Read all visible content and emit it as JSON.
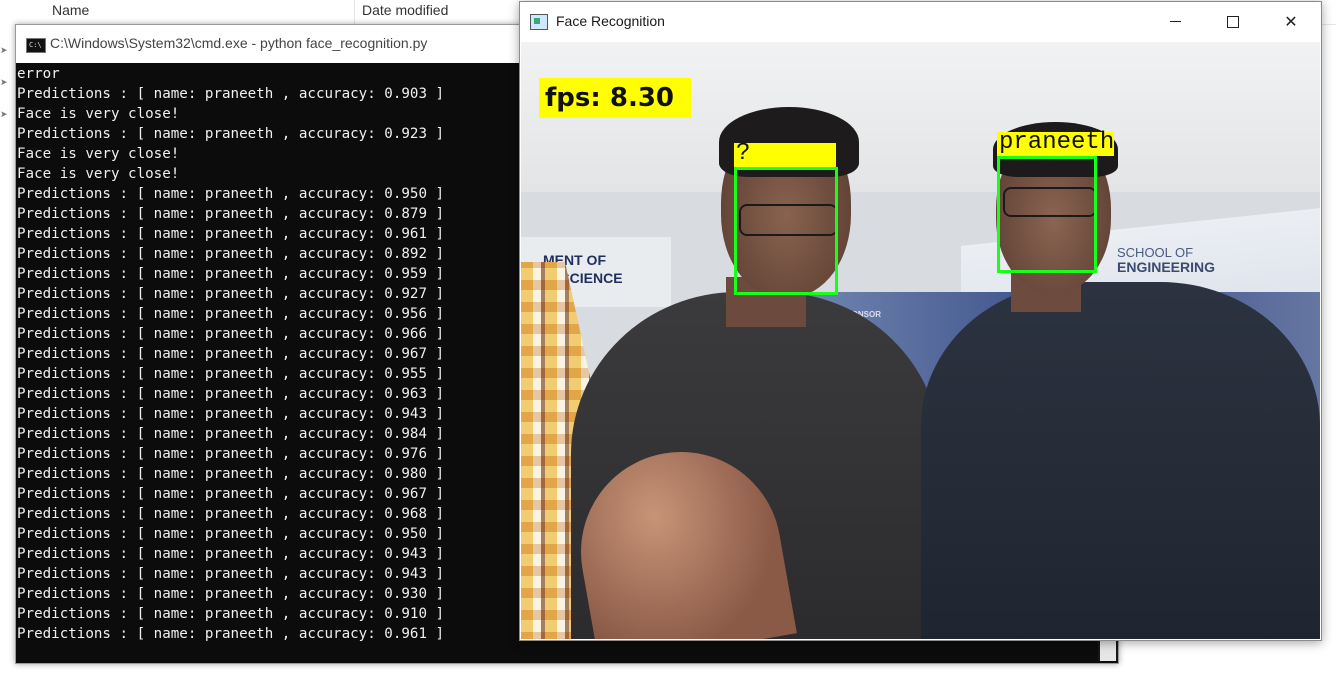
{
  "explorer": {
    "columns": [
      "Name",
      "Date modified"
    ]
  },
  "cmd": {
    "title": "C:\\Windows\\System32\\cmd.exe - python  face_recognition.py",
    "icon": "cmd-icon",
    "lines": [
      "error",
      "Predictions : [ name: praneeth , accuracy: 0.903 ]",
      "Face is very close!",
      "Predictions : [ name: praneeth , accuracy: 0.923 ]",
      "Face is very close!",
      "Face is very close!",
      "Predictions : [ name: praneeth , accuracy: 0.950 ]",
      "Predictions : [ name: praneeth , accuracy: 0.879 ]",
      "Predictions : [ name: praneeth , accuracy: 0.961 ]",
      "Predictions : [ name: praneeth , accuracy: 0.892 ]",
      "Predictions : [ name: praneeth , accuracy: 0.959 ]",
      "Predictions : [ name: praneeth , accuracy: 0.927 ]",
      "Predictions : [ name: praneeth , accuracy: 0.956 ]",
      "Predictions : [ name: praneeth , accuracy: 0.966 ]",
      "Predictions : [ name: praneeth , accuracy: 0.967 ]",
      "Predictions : [ name: praneeth , accuracy: 0.955 ]",
      "Predictions : [ name: praneeth , accuracy: 0.963 ]",
      "Predictions : [ name: praneeth , accuracy: 0.943 ]",
      "Predictions : [ name: praneeth , accuracy: 0.984 ]",
      "Predictions : [ name: praneeth , accuracy: 0.976 ]",
      "Predictions : [ name: praneeth , accuracy: 0.980 ]",
      "Predictions : [ name: praneeth , accuracy: 0.967 ]",
      "Predictions : [ name: praneeth , accuracy: 0.968 ]",
      "Predictions : [ name: praneeth , accuracy: 0.950 ]",
      "Predictions : [ name: praneeth , accuracy: 0.943 ]",
      "Predictions : [ name: praneeth , accuracy: 0.943 ]",
      "Predictions : [ name: praneeth , accuracy: 0.930 ]",
      "Predictions : [ name: praneeth , accuracy: 0.910 ]",
      "Predictions : [ name: praneeth , accuracy: 0.961 ]"
    ]
  },
  "face_window": {
    "title": "Face Recognition",
    "controls": {
      "minimize": "minimize-icon",
      "maximize": "maximize-icon",
      "close": "✕"
    },
    "overlay": {
      "fps": "fps: 8.30",
      "faces": [
        {
          "label": "?"
        },
        {
          "label": "praneeth"
        }
      ]
    },
    "background_text": {
      "left_line1": "MENT OF",
      "left_line2": "ER SCIENCE",
      "right_line1": "SCHOOL OF",
      "right_line2": "ENGINEERING",
      "sponsor": "SPONSOR"
    },
    "colors": {
      "label_bg": "#ffff00",
      "box": "#18ff18"
    }
  }
}
